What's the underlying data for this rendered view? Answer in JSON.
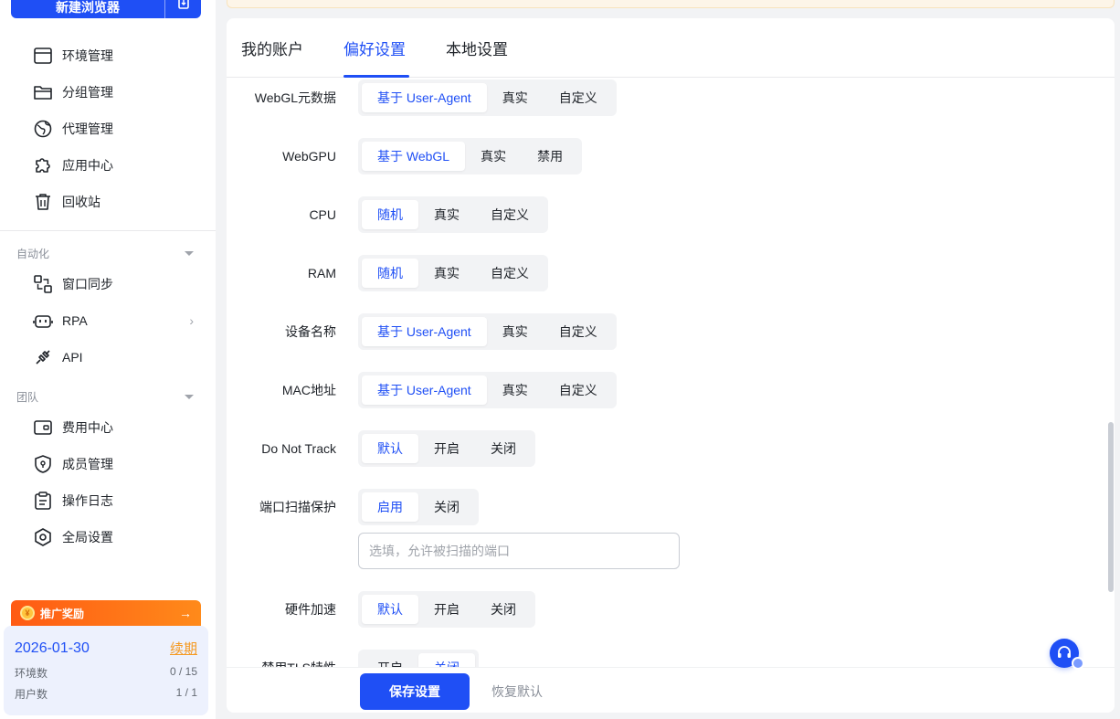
{
  "sidebar": {
    "new_browser_label": "新建浏览器",
    "items": [
      {
        "label": "环境管理",
        "icon": "window-icon"
      },
      {
        "label": "分组管理",
        "icon": "folder-icon"
      },
      {
        "label": "代理管理",
        "icon": "globe-icon"
      },
      {
        "label": "应用中心",
        "icon": "puzzle-icon"
      },
      {
        "label": "回收站",
        "icon": "trash-icon"
      }
    ],
    "automation": {
      "title": "自动化",
      "items": [
        {
          "label": "窗口同步",
          "icon": "sync-icon"
        },
        {
          "label": "RPA",
          "icon": "robot-icon"
        },
        {
          "label": "API",
          "icon": "plug-icon"
        }
      ]
    },
    "team": {
      "title": "团队",
      "items": [
        {
          "label": "费用中心",
          "icon": "wallet-icon"
        },
        {
          "label": "成员管理",
          "icon": "shield-icon"
        },
        {
          "label": "操作日志",
          "icon": "clipboard-icon"
        },
        {
          "label": "全局设置",
          "icon": "settings-icon"
        }
      ]
    },
    "promo": {
      "label": "推广奖励"
    },
    "plan": {
      "expire_date": "2026-01-30",
      "renew_label": "续期",
      "env_label": "环境数",
      "env_value": "0 / 15",
      "user_label": "用户数",
      "user_value": "1 / 1"
    }
  },
  "tabs": [
    {
      "label": "我的账户",
      "active": false
    },
    {
      "label": "偏好设置",
      "active": true
    },
    {
      "label": "本地设置",
      "active": false
    }
  ],
  "settings": [
    {
      "label": "WebGL元数据",
      "options": [
        "基于 User-Agent",
        "真实",
        "自定义"
      ],
      "selected": 0
    },
    {
      "label": "WebGPU",
      "options": [
        "基于 WebGL",
        "真实",
        "禁用"
      ],
      "selected": 0
    },
    {
      "label": "CPU",
      "options": [
        "随机",
        "真实",
        "自定义"
      ],
      "selected": 0
    },
    {
      "label": "RAM",
      "options": [
        "随机",
        "真实",
        "自定义"
      ],
      "selected": 0
    },
    {
      "label": "设备名称",
      "options": [
        "基于 User-Agent",
        "真实",
        "自定义"
      ],
      "selected": 0
    },
    {
      "label": "MAC地址",
      "options": [
        "基于 User-Agent",
        "真实",
        "自定义"
      ],
      "selected": 0
    },
    {
      "label": "Do Not Track",
      "options": [
        "默认",
        "开启",
        "关闭"
      ],
      "selected": 0
    },
    {
      "label": "端口扫描保护",
      "options": [
        "启用",
        "关闭"
      ],
      "selected": 0
    },
    {
      "label": "硬件加速",
      "options": [
        "默认",
        "开启",
        "关闭"
      ],
      "selected": 0
    },
    {
      "label": "禁用TLS特性",
      "options": [
        "开启",
        "关闭"
      ],
      "selected": 1
    }
  ],
  "port_input": {
    "placeholder": "选填，允许被扫描的端口",
    "value": ""
  },
  "footer": {
    "save_label": "保存设置",
    "reset_label": "恢复默认"
  },
  "colors": {
    "accent": "#1f4ff5",
    "promo": "#ff6a14",
    "renew": "#f59a23"
  }
}
